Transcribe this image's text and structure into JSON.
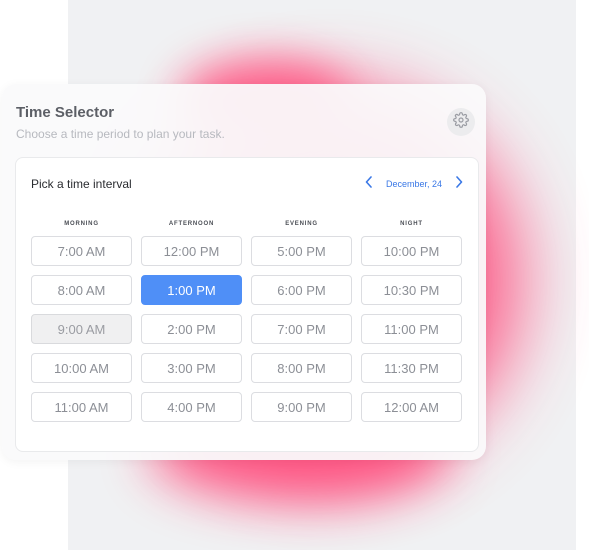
{
  "header": {
    "title": "Time Selector",
    "subtitle": "Choose a time period to plan your task."
  },
  "picker": {
    "label": "Pick a time interval",
    "date": "December, 24",
    "prev_icon": "chevron-left-icon",
    "next_icon": "chevron-right-icon",
    "settings_icon": "gear-icon"
  },
  "columns": [
    {
      "name": "MORNING",
      "slots": [
        "7:00 AM",
        "8:00 AM",
        "9:00 AM",
        "10:00 AM",
        "11:00 AM"
      ]
    },
    {
      "name": "AFTERNOON",
      "slots": [
        "12:00 PM",
        "1:00 PM",
        "2:00 PM",
        "3:00 PM",
        "4:00 PM"
      ]
    },
    {
      "name": "EVENING",
      "slots": [
        "5:00 PM",
        "6:00 PM",
        "7:00 PM",
        "8:00 PM",
        "9:00 PM"
      ]
    },
    {
      "name": "NIGHT",
      "slots": [
        "10:00 PM",
        "10:30 PM",
        "11:00 PM",
        "11:30 PM",
        "12:00 AM"
      ]
    }
  ],
  "selected_slot": "1:00 PM",
  "disabled_slot": "9:00 AM",
  "colors": {
    "accent": "#4f8ff7",
    "blob": "#ff3f73",
    "date_link": "#3a78e6"
  }
}
